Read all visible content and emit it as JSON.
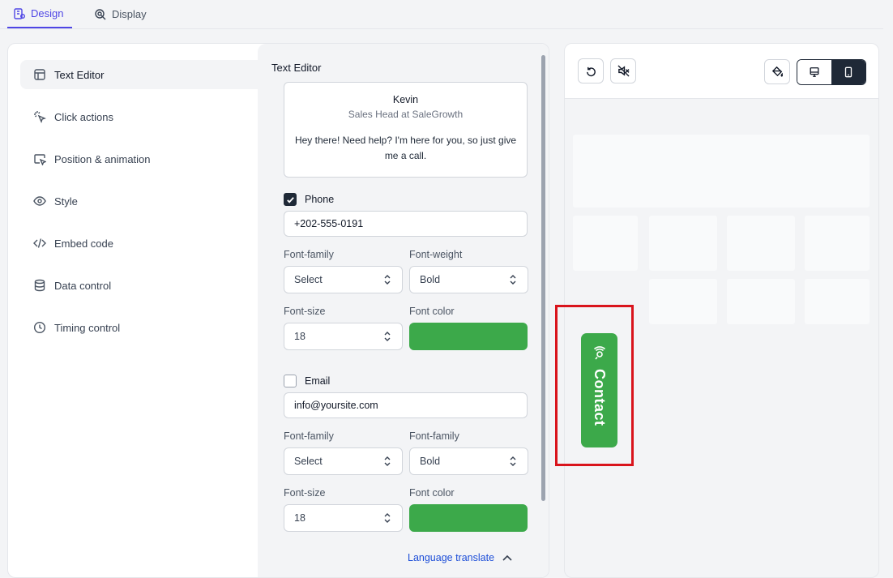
{
  "tabs": [
    {
      "label": "Design",
      "active": true
    },
    {
      "label": "Display",
      "active": false
    }
  ],
  "nav": {
    "items": [
      {
        "label": "Text Editor",
        "icon": "layout-icon",
        "active": true
      },
      {
        "label": "Click actions",
        "icon": "pointer-click-icon"
      },
      {
        "label": "Position & animation",
        "icon": "cursor-window-icon"
      },
      {
        "label": "Style",
        "icon": "eye-icon"
      },
      {
        "label": "Embed code",
        "icon": "code-icon"
      },
      {
        "label": "Data control",
        "icon": "database-icon"
      },
      {
        "label": "Timing control",
        "icon": "clock-icon"
      }
    ]
  },
  "editor": {
    "title": "Text Editor",
    "preview": {
      "name": "Kevin",
      "role": "Sales Head at SaleGrowth",
      "message": "Hey there! Need help? I'm here for you, so just give me a call."
    },
    "phone": {
      "label": "Phone",
      "checked": true,
      "value": "+202-555-0191",
      "font_family_label": "Font-family",
      "font_family_value": "Select",
      "font_weight_label": "Font-weight",
      "font_weight_value": "Bold",
      "font_size_label": "Font-size",
      "font_size_value": "18",
      "font_color_label": "Font color",
      "font_color": "#3ca94a"
    },
    "email": {
      "label": "Email",
      "checked": false,
      "value": "info@yoursite.com",
      "font_family_label": "Font-family",
      "font_family_value": "Select",
      "font_weight_label": "Font-family",
      "font_weight_value": "Bold",
      "font_size_label": "Font-size",
      "font_size_value": "18",
      "font_color_label": "Font color",
      "font_color": "#3ca94a"
    },
    "language_translate": "Language translate"
  },
  "preview_panel": {
    "toolbar_icons": [
      "undo-icon",
      "mute-icon",
      "paint-bucket-icon",
      "desktop-icon",
      "mobile-icon"
    ],
    "active_device": "mobile",
    "widget": {
      "label": "Contact",
      "icon": "phone-call-icon",
      "color": "#3ca94a"
    },
    "highlight_color": "#d9141c"
  }
}
